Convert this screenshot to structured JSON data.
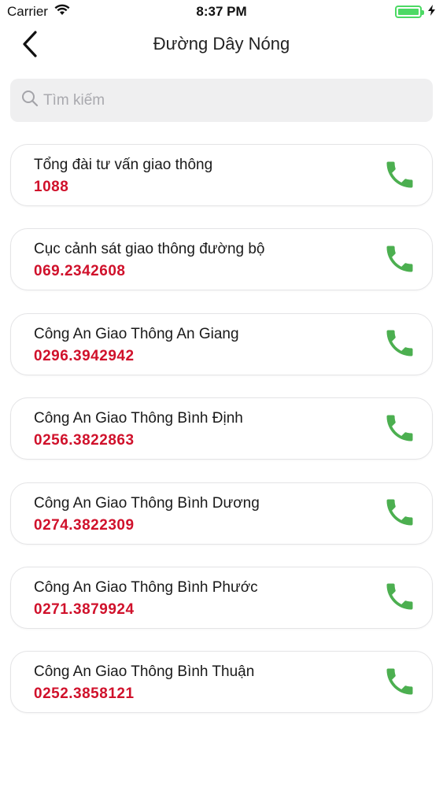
{
  "status_bar": {
    "carrier": "Carrier",
    "time": "8:37 PM",
    "battery_level": 1.0,
    "charging_icon": "bolt-icon"
  },
  "nav": {
    "title": "Đường Dây Nóng",
    "back_icon": "chevron-left-icon"
  },
  "search": {
    "placeholder": "Tìm kiếm",
    "value": ""
  },
  "colors": {
    "number_red": "#d0112b",
    "call_green": "#4caf50",
    "battery_green": "#4cd964"
  },
  "hotlines": [
    {
      "name": "Tổng đài tư vấn giao thông",
      "number": "1088"
    },
    {
      "name": "Cục cảnh sát giao thông đường bộ",
      "number": "069.2342608"
    },
    {
      "name": "Công An Giao Thông An Giang",
      "number": "0296.3942942"
    },
    {
      "name": "Công An Giao Thông Bình Định",
      "number": "0256.3822863"
    },
    {
      "name": "Công An Giao Thông Bình Dương",
      "number": "0274.3822309"
    },
    {
      "name": "Công An Giao Thông Bình Phước",
      "number": "0271.3879924"
    },
    {
      "name": "Công An Giao Thông Bình Thuận",
      "number": "0252.3858121"
    }
  ]
}
